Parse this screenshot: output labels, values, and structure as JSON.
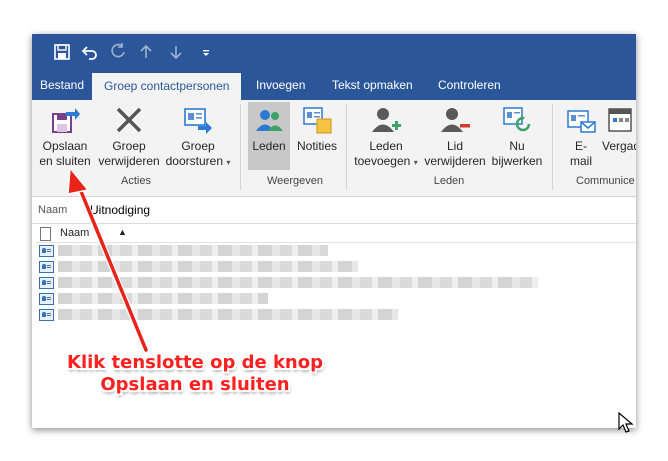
{
  "quick_access": {
    "icons": [
      "save-icon",
      "undo-icon",
      "redo-icon",
      "up-arrow-icon",
      "down-arrow-icon",
      "customize-icon"
    ]
  },
  "tabs": [
    {
      "label": "Bestand",
      "active": false
    },
    {
      "label": "Groep contactpersonen",
      "active": true
    },
    {
      "label": "Invoegen",
      "active": false
    },
    {
      "label": "Tekst opmaken",
      "active": false
    },
    {
      "label": "Controleren",
      "active": false
    }
  ],
  "ribbon": {
    "groups": [
      {
        "label": "Acties",
        "buttons": [
          {
            "line1": "Opslaan",
            "line2": "en sluiten",
            "icon": "save-close-icon"
          },
          {
            "line1": "Groep",
            "line2": "verwijderen",
            "icon": "delete-x-icon"
          },
          {
            "line1": "Groep",
            "line2": "doorsturen",
            "icon": "forward-group-icon"
          }
        ]
      },
      {
        "label": "Weergeven",
        "buttons": [
          {
            "line1": "Leden",
            "line2": "",
            "icon": "members-icon",
            "selected": true
          },
          {
            "line1": "Notities",
            "line2": "",
            "icon": "notes-icon"
          }
        ]
      },
      {
        "label": "Leden",
        "buttons": [
          {
            "line1": "Leden",
            "line2": "toevoegen",
            "icon": "add-member-icon"
          },
          {
            "line1": "Lid",
            "line2": "verwijderen",
            "icon": "remove-member-icon"
          },
          {
            "line1": "Nu",
            "line2": "bijwerken",
            "icon": "update-now-icon"
          }
        ]
      },
      {
        "label": "Communice",
        "buttons": [
          {
            "line1": "E-",
            "line2": "mail",
            "icon": "email-icon"
          },
          {
            "line1": "Vergad",
            "line2": "",
            "icon": "meeting-icon"
          }
        ]
      }
    ]
  },
  "name_field": {
    "label": "Naam",
    "value": "Uitnodiging"
  },
  "list": {
    "column_header": "Naam",
    "sort": "ascending",
    "rows": 5
  },
  "annotation": {
    "line1": "Klik tenslotte op de knop",
    "line2": "Opslaan en sluiten",
    "color": "#ff2020"
  },
  "colors": {
    "title_bar": "#2b579a",
    "ribbon": "#f3f3f3"
  }
}
